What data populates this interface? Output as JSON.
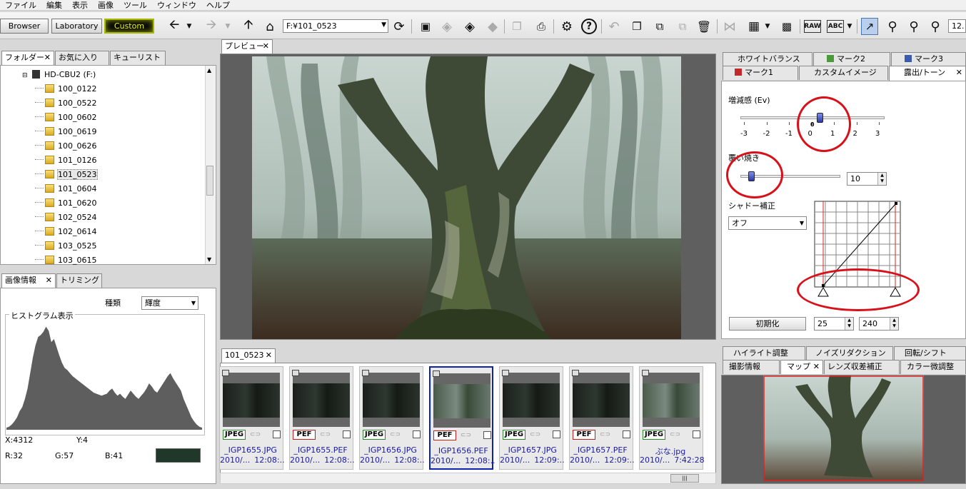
{
  "menu": [
    "ファイル",
    "編集",
    "表示",
    "画像",
    "ツール",
    "ウィンドウ",
    "ヘルプ"
  ],
  "modes": {
    "browser": "Browser",
    "laboratory": "Laboratory",
    "custom": "Custom"
  },
  "path": "F:¥101_0523",
  "zoom": "12.",
  "folder_tabs": [
    "フォルダー",
    "お気に入り",
    "キューリスト"
  ],
  "drive": "HD-CBU2 (F:)",
  "folders": [
    "100_0122",
    "100_0522",
    "100_0602",
    "100_0619",
    "100_0626",
    "101_0126",
    "101_0523",
    "101_0604",
    "101_0620",
    "102_0524",
    "102_0614",
    "103_0525",
    "103_0615"
  ],
  "selected_folder": "101_0523",
  "info_tabs": [
    "画像情報",
    "トリミング"
  ],
  "kind_label": "種類",
  "kind_value": "輝度",
  "histogram_label": "ヒストグラム表示",
  "histogram_values": [
    2,
    3,
    5,
    8,
    12,
    18,
    22,
    30,
    40,
    55,
    70,
    82,
    90,
    92,
    95,
    100,
    96,
    85,
    88,
    80,
    72,
    65,
    60,
    58,
    55,
    52,
    50,
    48,
    46,
    44,
    42,
    40,
    38,
    36,
    35,
    34,
    33,
    34,
    35,
    38,
    40,
    36,
    33,
    35,
    32,
    30,
    34,
    38,
    35,
    32,
    30,
    33,
    36,
    40,
    45,
    42,
    38,
    36,
    40,
    44,
    48,
    52,
    55,
    50,
    46,
    42,
    38,
    30,
    24,
    18,
    12,
    8,
    5,
    3,
    2
  ],
  "coords": {
    "x": "X:4312",
    "y": "Y:4"
  },
  "rgb": {
    "r": "R:32",
    "g": "G:57",
    "b": "B:41"
  },
  "swatch": "#20382a",
  "preview_tab": "プレビュー",
  "film_tab": "101_0523",
  "thumbnails": [
    {
      "type": "JPEG",
      "name": "_IGP1655.JPG",
      "date": "2010/...",
      "time": "12:08:..",
      "dark": true,
      "selected": false
    },
    {
      "type": "PEF",
      "name": "_IGP1655.PEF",
      "date": "2010/...",
      "time": "12:08:..",
      "dark": true,
      "selected": false
    },
    {
      "type": "JPEG",
      "name": "_IGP1656.JPG",
      "date": "2010/...",
      "time": "12:08:..",
      "dark": true,
      "selected": false
    },
    {
      "type": "PEF",
      "name": "_IGP1656.PEF",
      "date": "2010/...",
      "time": "12:08:..",
      "dark": false,
      "selected": true
    },
    {
      "type": "JPEG",
      "name": "_IGP1657.JPG",
      "date": "2010/...",
      "time": "12:09:..",
      "dark": true,
      "selected": false
    },
    {
      "type": "PEF",
      "name": "_IGP1657.PEF",
      "date": "2010/...",
      "time": "12:09:..",
      "dark": true,
      "selected": false
    },
    {
      "type": "JPEG",
      "name": "ぶな.jpg",
      "date": "2010/...",
      "time": "7:42:28",
      "dark": false,
      "selected": false
    }
  ],
  "adjust_tabs_row1": [
    "ホワイトバランス",
    "マーク2",
    "マーク3"
  ],
  "adjust_tabs_row2": [
    "マーク1",
    "カスタムイメージ",
    "露出/トーン"
  ],
  "exposure_label": "増減感 (Ev)",
  "exposure_ticks": [
    "-3",
    "-2",
    "-1",
    "0",
    "1",
    "2",
    "3"
  ],
  "exposure_value_indicator": "0",
  "exposure_value": 0.33,
  "dodge_label": "覆い焼き",
  "dodge_value": "10",
  "shadow_label": "シャドー補正",
  "shadow_value": "オフ",
  "reset_label": "初期化",
  "curve_low": "25",
  "curve_high": "240",
  "bottom_tabs_row1": [
    "ハイライト調整",
    "ノイズリダクション",
    "回転/シフト"
  ],
  "bottom_tabs_row2": [
    "撮影情報",
    "マップ",
    "レンズ収差補正",
    "カラー微調整"
  ]
}
